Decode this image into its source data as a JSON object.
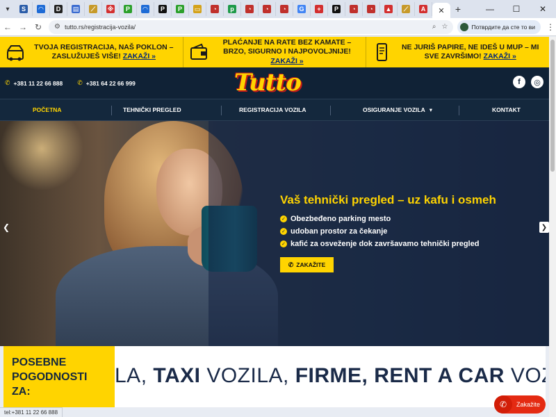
{
  "browser": {
    "favicons": [
      {
        "glyph": "S",
        "color": "#2a5ca8"
      },
      {
        "glyph": "◠",
        "color": "#1e6bd6"
      },
      {
        "glyph": "D",
        "color": "#222222"
      },
      {
        "glyph": "▤",
        "color": "#3a6bd0"
      },
      {
        "glyph": "⟋",
        "color": "#c79a2a"
      },
      {
        "glyph": "※",
        "color": "#d33030"
      },
      {
        "glyph": "P",
        "color": "#2ca02c"
      },
      {
        "glyph": "◠",
        "color": "#1e6bd6"
      },
      {
        "glyph": "P",
        "color": "#111111"
      },
      {
        "glyph": "P",
        "color": "#2ca02c"
      },
      {
        "glyph": "▭",
        "color": "#d4a21a"
      },
      {
        "glyph": "◔",
        "color": "#c0302c"
      },
      {
        "glyph": "p",
        "color": "#1e9a4a"
      },
      {
        "glyph": "◔",
        "color": "#c0302c"
      },
      {
        "glyph": "◔",
        "color": "#c0302c"
      },
      {
        "glyph": "◔",
        "color": "#c0302c"
      },
      {
        "glyph": "G",
        "color": "#4285f4"
      },
      {
        "glyph": "+",
        "color": "#d32f2f"
      },
      {
        "glyph": "P",
        "color": "#111111"
      },
      {
        "glyph": "◔",
        "color": "#c0302c"
      },
      {
        "glyph": "◔",
        "color": "#c0302c"
      },
      {
        "glyph": "▲",
        "color": "#d32f2f"
      },
      {
        "glyph": "⟋",
        "color": "#c79a2a"
      },
      {
        "glyph": "A",
        "color": "#d32f2f"
      }
    ],
    "active_tab_close": "✕",
    "new_tab": "+",
    "url": "tutto.rs/registracija-vozila/",
    "profile_label": "Потврдите да сте то ви",
    "win_minimize": "—",
    "win_maximize": "☐",
    "win_close": "✕"
  },
  "promo": [
    {
      "text": "TVOJA REGISTRACIJA, NAŠ POKLON – ZASLUŽUJEŠ VIŠE!",
      "link": "ZAKAŽI »"
    },
    {
      "text": "PLAĆANJE NA RATE BEZ KAMATE – BRZO, SIGURNO I NAJPOVOLJNIJE!",
      "link": "ZAKAŽI »"
    },
    {
      "text": "NE JURIŠ PAPIRE, NE IDEŠ U MUP – MI SVE ZAVRŠIMO!",
      "link": "ZAKAŽI »"
    }
  ],
  "header": {
    "phone1": "+381 11 22 66 888",
    "phone2": "+381 64 22 66 999",
    "logo": "Tutto",
    "facebook": "f",
    "instagram": "◎"
  },
  "nav": {
    "items": [
      "POČETNA",
      "TEHNIČKI PREGLED",
      "REGISTRACIJA VOZILA",
      "OSIGURANJE VOZILA",
      "KONTAKT"
    ],
    "dropdown_glyph": "▾"
  },
  "hero": {
    "title": "Vaš tehnički pregled – uz kafu i osmeh",
    "features": [
      "Obezbeđeno parking mesto",
      "udoban prostor za čekanje",
      "kafić za osveženje dok završavamo tehnički pregled"
    ],
    "cta": "ZAKAŽITE",
    "check_glyph": "✓",
    "prev": "❮",
    "next": "❯"
  },
  "ticker": {
    "label": "POSEBNE POGODNOSTI ZA:",
    "segments": [
      {
        "bold": "",
        "normal": "LA, "
      },
      {
        "bold": "TAXI",
        "normal": " VOZILA, "
      },
      {
        "bold": "FIRME, ",
        "normal": ""
      },
      {
        "bold": "RENT A CAR",
        "normal": " VOZ"
      }
    ]
  },
  "status_text": "tel:+381 11 22 66 888",
  "float_call": {
    "label": "Zakažite",
    "icon": "✆"
  },
  "colors": {
    "accent": "#ffd400",
    "dark": "#102236",
    "call": "#e42a12"
  }
}
